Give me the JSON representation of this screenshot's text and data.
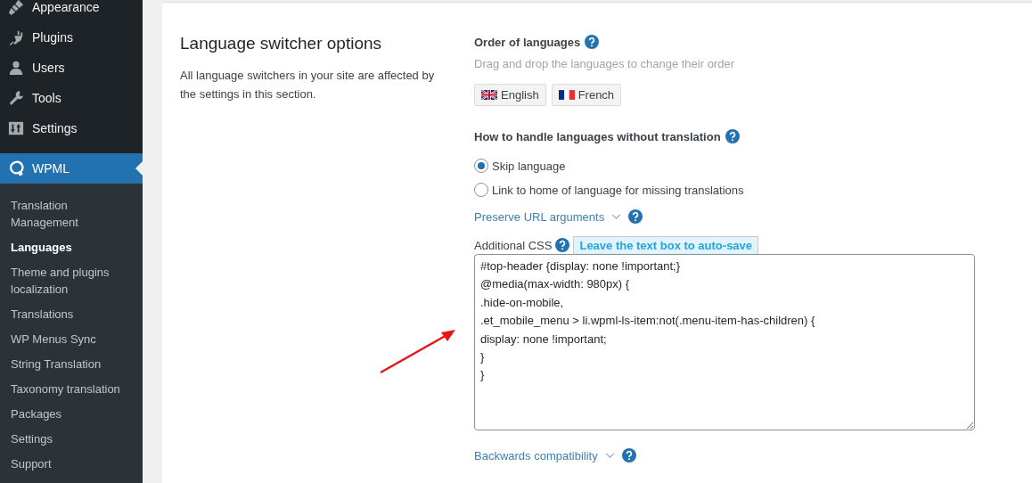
{
  "sidebar": {
    "menu": [
      {
        "label": "Appearance",
        "selected": false
      },
      {
        "label": "Plugins",
        "selected": false
      },
      {
        "label": "Users",
        "selected": false
      },
      {
        "label": "Tools",
        "selected": false
      },
      {
        "label": "Settings",
        "selected": false
      },
      {
        "label": "WPML",
        "selected": true
      }
    ],
    "submenu": [
      {
        "label": "Translation Management",
        "selected": false
      },
      {
        "label": "Languages",
        "selected": true
      },
      {
        "label": "Theme and plugins localization",
        "selected": false
      },
      {
        "label": "Translations",
        "selected": false
      },
      {
        "label": "WP Menus Sync",
        "selected": false
      },
      {
        "label": "String Translation",
        "selected": false
      },
      {
        "label": "Taxonomy translation",
        "selected": false
      },
      {
        "label": "Packages",
        "selected": false
      },
      {
        "label": "Settings",
        "selected": false
      },
      {
        "label": "Support",
        "selected": false
      }
    ]
  },
  "section": {
    "title": "Language switcher options",
    "description": "All language switchers in your site are affected by the settings in this section."
  },
  "order": {
    "heading": "Order of languages",
    "hint": "Drag and drop the languages to change their order",
    "languages": [
      {
        "label": "English"
      },
      {
        "label": "French"
      }
    ]
  },
  "missing": {
    "heading": "How to handle languages without translation",
    "options": [
      {
        "label": "Skip language",
        "selected": true
      },
      {
        "label": "Link to home of language for missing translations",
        "selected": false
      }
    ]
  },
  "preserve_link": "Preserve URL arguments",
  "css": {
    "label": "Additional CSS",
    "notice": "Leave the text box to auto-save",
    "lines": [
      "#top-header {display: none !important;}",
      "@media(max-width: 980px) {",
      ".hide-on-mobile,",
      ".et_mobile_menu > li.wpml-ls-item:not(.menu-item-has-children) {",
      "display: none !important;",
      "}",
      "}"
    ]
  },
  "backwards_link": "Backwards compatibility"
}
